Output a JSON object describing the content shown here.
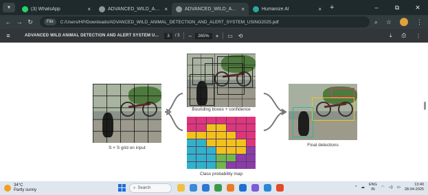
{
  "browser": {
    "tabs": [
      {
        "title": "(3) WhatsApp",
        "favicon_color": "#25d366",
        "active": false
      },
      {
        "title": "ADVANCED_WILD_ANIMAL_D",
        "favicon_color": "#8a9a9a",
        "active": false
      },
      {
        "title": "ADVANCED_WILD_ANIMAL_D",
        "favicon_color": "#8a9a9a",
        "active": true
      },
      {
        "title": "Humanize AI",
        "favicon_color": "#2aa6a0",
        "active": false
      }
    ],
    "tab_close_glyph": "×",
    "new_tab_glyph": "+",
    "window_controls": [
      "–",
      "⧉",
      "✕"
    ],
    "address": {
      "chip": "File",
      "url": "C:/Users/HP/Downloads/ADVANCED_WILD_ANIMAL_DETECTION_AND_ALERT_SYSTEM_USING2025.pdf"
    }
  },
  "pdf_toolbar": {
    "title": "ADVANCED WILD ANIMAL DETECTION AND ALERT SYSTEM U...",
    "page_current": "3",
    "page_total": "/ 3",
    "zoom_minus": "–",
    "zoom": "265%",
    "zoom_plus": "+"
  },
  "figure": {
    "caption_input": "S × S grid on input",
    "caption_bbox": "Bounding boxes + confidence",
    "caption_probmap": "Class probability map",
    "caption_final": "Final detections",
    "colors": {
      "grid_line": "#111111",
      "box_red": "#e33a3a",
      "box_yellow": "#f2c21a",
      "box_pink": "#e0357a",
      "box_teal": "#2bb5a8"
    },
    "prob_map": [
      [
        "#e0357a",
        "#e0357a",
        "#e0357a",
        "#e0357a",
        "#e0357a",
        "#e0357a",
        "#e0357a"
      ],
      [
        "#e0357a",
        "#e0357a",
        "#f2c21a",
        "#f2c21a",
        "#e0357a",
        "#e0357a",
        "#e0357a"
      ],
      [
        "#f2c21a",
        "#f2c21a",
        "#f2c21a",
        "#f2c21a",
        "#f2c21a",
        "#e0357a",
        "#e0357a"
      ],
      [
        "#2fb3c9",
        "#2fb3c9",
        "#f2c21a",
        "#f2c21a",
        "#f2c21a",
        "#f2c21a",
        "#e0357a"
      ],
      [
        "#2fb3c9",
        "#2fb3c9",
        "#2fb3c9",
        "#f2c21a",
        "#f2c21a",
        "#f2c21a",
        "#8a3da6"
      ],
      [
        "#2fb3c9",
        "#2fb3c9",
        "#2fb3c9",
        "#6fb84a",
        "#6fb84a",
        "#8a3da6",
        "#8a3da6"
      ],
      [
        "#2fb3c9",
        "#2fb3c9",
        "#2fb3c9",
        "#6fb84a",
        "#8a3da6",
        "#8a3da6",
        "#8a3da6"
      ]
    ]
  },
  "taskbar": {
    "weather_temp": "34°C",
    "weather_desc": "Partly sunny",
    "search_placeholder": "Search",
    "app_icon_colors": [
      "#f0c040",
      "#3b8ad6",
      "#2b78d4",
      "#3a9a4a",
      "#ee7a22",
      "#1f6fd1",
      "#7a5cd6",
      "#2a88d8",
      "#e24a2a"
    ],
    "lang": "ENG",
    "lang_region": "IN",
    "time": "13:40",
    "date": "28-04-2025"
  }
}
